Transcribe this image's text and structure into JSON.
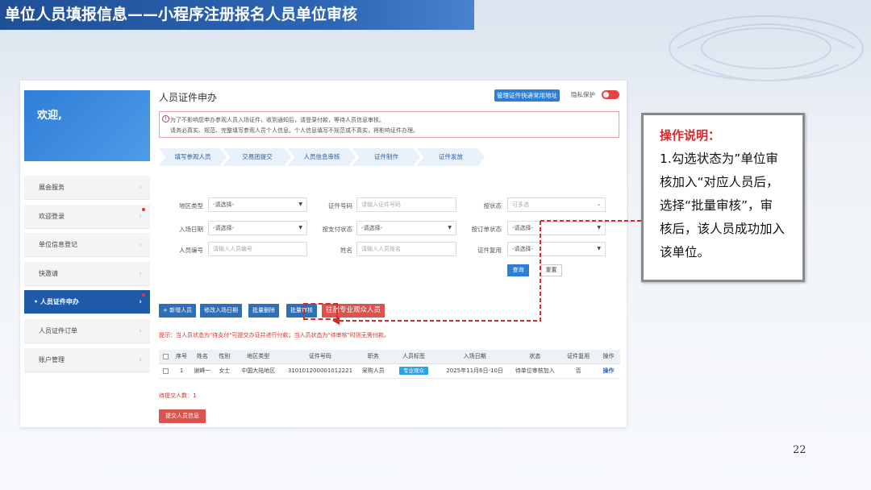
{
  "slide": {
    "title": "单位人员填报信息——小程序注册报名人员单位审核",
    "page_number": "22"
  },
  "sidebar": {
    "welcome": "欢迎,",
    "items": [
      {
        "label": "展会服务",
        "active": false,
        "dot": false
      },
      {
        "label": "欢迎登录",
        "active": false,
        "dot": true
      },
      {
        "label": "单位信息登记",
        "active": false,
        "dot": false
      },
      {
        "label": "快邀请",
        "active": false,
        "dot": false
      },
      {
        "label": "人员证件申办",
        "active": true,
        "dot": true
      },
      {
        "label": "人员证件订单",
        "active": false,
        "dot": false
      },
      {
        "label": "账户管理",
        "active": false,
        "dot": false
      }
    ]
  },
  "header": {
    "page_title": "人员证件申办",
    "manage_button": "管理证件快递常用地址",
    "privacy_label": "隐私保护"
  },
  "notice": {
    "line1": "为了不影响您申办参观人员入场证件，收到通知后，请登录付款，等待人员信息审核。",
    "line2": "请务必真实、规范、完整填写参观人员个人信息。个人信息填写不规范或不真实，将影响证件办理。"
  },
  "steps": [
    "填写参观人员",
    "交易团提交",
    "人员信息审核",
    "证件制作",
    "证件发放"
  ],
  "filters": {
    "region_type": {
      "label": "地区类型",
      "value": "-请选择-"
    },
    "cert_no": {
      "label": "证件号码",
      "placeholder": "请输入证件号码"
    },
    "status": {
      "label": "按状态",
      "placeholder": "可多选"
    },
    "entry_date": {
      "label": "入场日期",
      "value": "-请选择-"
    },
    "pay_status": {
      "label": "按支付状态",
      "value": "-请选择-"
    },
    "order_status": {
      "label": "按订单状态",
      "value": "-请选择-"
    },
    "person_no": {
      "label": "人员编号",
      "placeholder": "请输入人员编号"
    },
    "name": {
      "label": "姓名",
      "placeholder": "请输入人员姓名"
    },
    "cert_reuse": {
      "label": "证件复用",
      "value": "-请选择-"
    },
    "query_button": "查询",
    "reset_button": "重置"
  },
  "actions": {
    "add": "+ 新增人员",
    "modify_date": "修改入场日期",
    "batch_delete": "批量删除",
    "batch_review": "批量审核",
    "past_visitors": "往届专业观众人员"
  },
  "hint": "提示：当人员状态为\"待支付\"可提交办证并进行付款；当人员状态为\"待审核\"时则无需付款。",
  "table": {
    "headers": [
      "序号",
      "姓名",
      "性别",
      "地区类型",
      "证件号码",
      "职务",
      "人员标签",
      "入场日期",
      "状态",
      "证件复用",
      "操作"
    ],
    "rows": [
      {
        "no": "1",
        "name": "谢峰一",
        "gender": "女士",
        "region": "中国大陆地区",
        "cert": "310101200001012221",
        "position": "采购人员",
        "tag": "专业观众",
        "date": "2025年11月6日-10日",
        "status": "待单位审核加入",
        "reuse": "否",
        "op": "操作"
      }
    ]
  },
  "pending": "待提交人数：1",
  "submit_button": "提交人员信息",
  "explanation": {
    "title": "操作说明：",
    "line1": "1.勾选状态为”单位审",
    "line2": "核加入“对应人员后，",
    "line3": "选择“批量审核”，审",
    "line4": "核后，该人员成功加入",
    "line5": "该单位。"
  },
  "colors": {
    "brand_blue": "#1e5aa8",
    "accent_red": "#d42a2a",
    "tag_blue": "#29a3e6"
  }
}
